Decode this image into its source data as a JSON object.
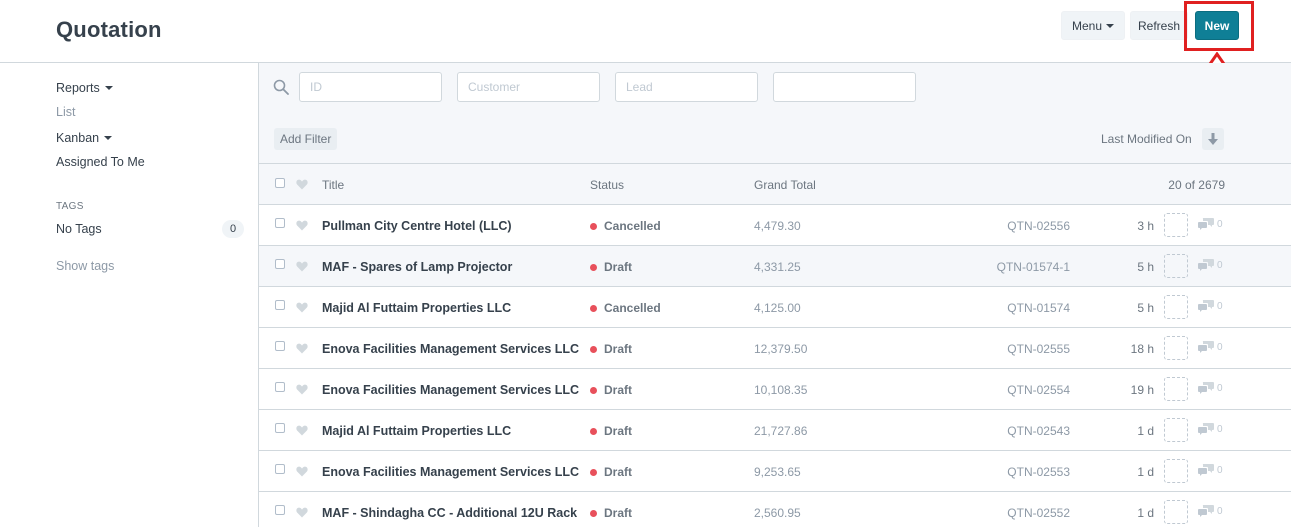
{
  "header": {
    "title": "Quotation",
    "menu_label": "Menu",
    "refresh_label": "Refresh",
    "new_label": "New"
  },
  "sidebar": {
    "reports": "Reports",
    "list": "List",
    "kanban": "Kanban",
    "assigned": "Assigned To Me",
    "tags_heading": "TAGS",
    "no_tags": "No Tags",
    "no_tags_count": "0",
    "show_tags": "Show tags"
  },
  "filters": {
    "id_placeholder": "ID",
    "customer_placeholder": "Customer",
    "lead_placeholder": "Lead",
    "extra_placeholder": "",
    "add_filter": "Add Filter",
    "sort_label": "Last Modified On"
  },
  "list": {
    "col_title": "Title",
    "col_status": "Status",
    "col_total": "Grand Total",
    "count": "20 of 2679",
    "rows": [
      {
        "title": "Pullman City Centre Hotel (LLC)",
        "status": "Cancelled",
        "total": "4,479.30",
        "id": "QTN-02556",
        "time": "3 h",
        "comments": "0"
      },
      {
        "title": "MAF - Spares of Lamp Projector",
        "status": "Draft",
        "total": "4,331.25",
        "id": "QTN-01574-1",
        "time": "5 h",
        "comments": "0"
      },
      {
        "title": "Majid Al Futtaim Properties LLC",
        "status": "Cancelled",
        "total": "4,125.00",
        "id": "QTN-01574",
        "time": "5 h",
        "comments": "0"
      },
      {
        "title": "Enova Facilities Management Services LLC",
        "status": "Draft",
        "total": "12,379.50",
        "id": "QTN-02555",
        "time": "18 h",
        "comments": "0"
      },
      {
        "title": "Enova Facilities Management Services LLC",
        "status": "Draft",
        "total": "10,108.35",
        "id": "QTN-02554",
        "time": "19 h",
        "comments": "0"
      },
      {
        "title": "Majid Al Futtaim Properties LLC",
        "status": "Draft",
        "total": "21,727.86",
        "id": "QTN-02543",
        "time": "1 d",
        "comments": "0"
      },
      {
        "title": "Enova Facilities Management Services LLC",
        "status": "Draft",
        "total": "9,253.65",
        "id": "QTN-02553",
        "time": "1 d",
        "comments": "0"
      },
      {
        "title": "MAF - Shindagha CC - Additional 12U Rack",
        "status": "Draft",
        "total": "2,560.95",
        "id": "QTN-02552",
        "time": "1 d",
        "comments": "0"
      }
    ]
  },
  "colors": {
    "primary": "#0f7f96",
    "status_dot": "#e8505b",
    "highlight": "#e02020"
  },
  "icons": {
    "search": "search-icon",
    "heart": "heart-icon",
    "comment": "comment-icon",
    "sort": "sort-descending-icon",
    "arrow": "up-arrow-annotation-icon"
  }
}
